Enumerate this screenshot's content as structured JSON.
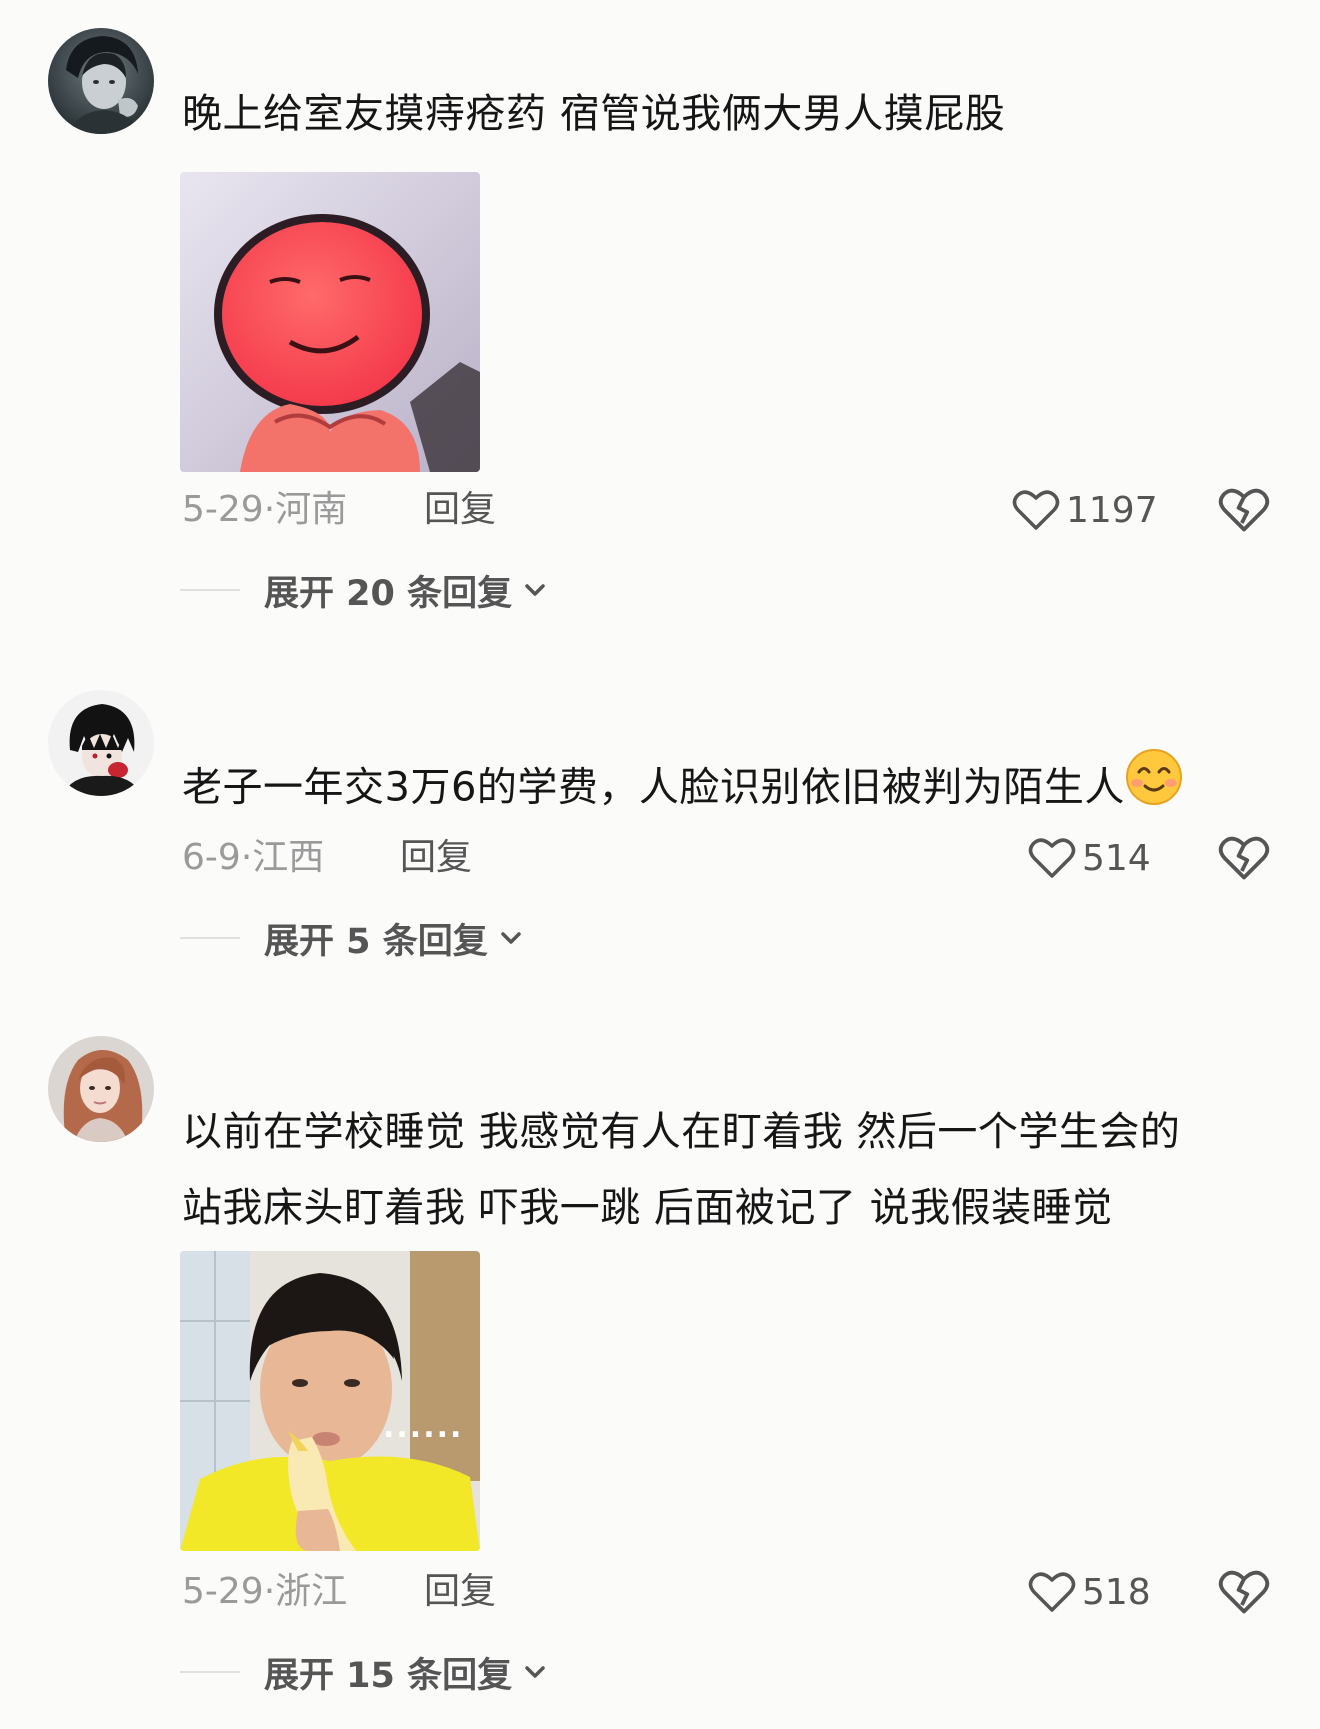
{
  "comments": [
    {
      "text": "晚上给室友摸痔疮药 宿管说我俩大男人摸屁股",
      "date": "5-29",
      "location": "河南",
      "reply_label": "回复",
      "likes": "1197",
      "expand_label": "展开 20 条回复",
      "avatar_icon": "user-avatar-boy-hand-chin",
      "sticker_icon": "red-smiling-face-sticker"
    },
    {
      "text": "老子一年交3万6的学费，人脸识别依旧被判为陌生人",
      "emoji": "smiling-face-emoji",
      "date": "6-9",
      "location": "江西",
      "reply_label": "回复",
      "likes": "514",
      "expand_label": "展开 5 条回复",
      "avatar_icon": "user-avatar-anime-dark-hair"
    },
    {
      "text_line1": "以前在学校睡觉 我感觉有人在盯着我 然后一个学生会的",
      "text_line2": "站我床头盯着我 吓我一跳 后面被记了 说我假装睡觉",
      "date": "5-29",
      "location": "浙江",
      "reply_label": "回复",
      "likes": "518",
      "expand_label": "展开 15 条回复",
      "avatar_icon": "user-avatar-girl-long-hair",
      "sticker_icon": "boy-eating-banana-sticker",
      "sticker_caption": "......"
    }
  ],
  "colors": {
    "background": "#fbfbfa",
    "text": "#161616",
    "meta": "#9a9a9a",
    "action": "#555555"
  },
  "icons": {
    "like": "heart-outline-icon",
    "dislike": "broken-heart-icon",
    "expand": "chevron-down-icon"
  }
}
